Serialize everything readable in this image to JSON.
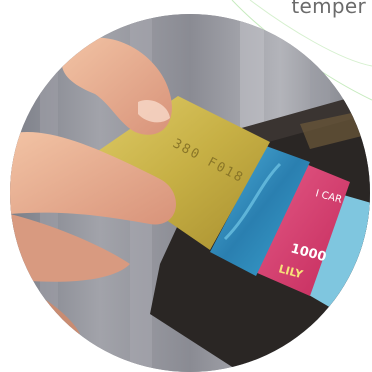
{
  "caption": {
    "text": "temper"
  },
  "photo": {
    "subject": "hand pulling credit card from wallet",
    "card_embossed_text": "380 F018",
    "pink_card_text_1": "I CAR",
    "pink_card_text_2": "1000",
    "pink_card_text_3": "LILY"
  },
  "colors": {
    "gold_card": "#c9b44a",
    "blue_card": "#2f8fbd",
    "pink_card": "#d83a6c",
    "light_blue_card": "#7fc6df",
    "wallet": "#2a2624",
    "background_stripes": "#8c8c92",
    "decor_line": "#b9e6b0"
  }
}
